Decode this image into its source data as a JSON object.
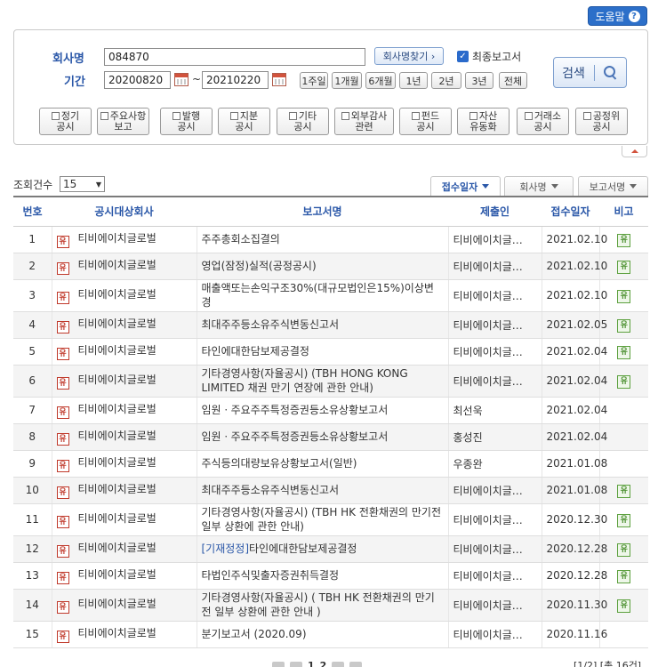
{
  "help": {
    "label": "도움말",
    "icon": "question-icon"
  },
  "search": {
    "company_label": "회사명",
    "company_value": "084870",
    "find_company_label": "회사명찾기 ›",
    "final_report_label": "최종보고서",
    "final_report_checked": true,
    "period_label": "기간",
    "start_date": "20200820",
    "end_date": "20210220",
    "period_sep": "~",
    "period_buttons": [
      "1주일",
      "1개월",
      "6개월",
      "1년",
      "2년",
      "3년",
      "전체"
    ],
    "search_label": "검색",
    "type_buttons": [
      [
        "정기",
        "공시"
      ],
      [
        "주요사항",
        "보고"
      ],
      [
        "발행",
        "공시"
      ],
      [
        "지분",
        "공시"
      ],
      [
        "기타",
        "공시"
      ],
      [
        "외부감사",
        "관련"
      ],
      [
        "펀드",
        "공시"
      ],
      [
        "자산",
        "유동화"
      ],
      [
        "거래소",
        "공시"
      ],
      [
        "공정위",
        "공시"
      ]
    ]
  },
  "list": {
    "count_label": "조회건수",
    "count_value": "15",
    "sort_buttons": [
      "접수일자",
      "회사명",
      "보고서명"
    ],
    "active_sort": "접수일자",
    "headers": [
      "번호",
      "공시대상회사",
      "보고서명",
      "제출인",
      "접수일자",
      "비고"
    ],
    "corp_icon": "유",
    "remark_icon": "유",
    "rows": [
      {
        "no": "1",
        "company": "티비에이치글로벌",
        "report_tag": "",
        "report": "주주총회소집결의",
        "submitter": "티비에이치글…",
        "date": "2021.02.10",
        "remark": true
      },
      {
        "no": "2",
        "company": "티비에이치글로벌",
        "report_tag": "",
        "report": "영업(잠정)실적(공정공시)",
        "submitter": "티비에이치글…",
        "date": "2021.02.10",
        "remark": true
      },
      {
        "no": "3",
        "company": "티비에이치글로벌",
        "report_tag": "",
        "report": "매출액또는손익구조30%(대규모법인은15%)이상변경",
        "submitter": "티비에이치글…",
        "date": "2021.02.10",
        "remark": true
      },
      {
        "no": "4",
        "company": "티비에이치글로벌",
        "report_tag": "",
        "report": "최대주주등소유주식변동신고서",
        "submitter": "티비에이치글…",
        "date": "2021.02.05",
        "remark": true
      },
      {
        "no": "5",
        "company": "티비에이치글로벌",
        "report_tag": "",
        "report": "타인에대한담보제공결정",
        "submitter": "티비에이치글…",
        "date": "2021.02.04",
        "remark": true
      },
      {
        "no": "6",
        "company": "티비에이치글로벌",
        "report_tag": "",
        "report": "기타경영사항(자율공시) (TBH HONG KONG LIMITED 채권 만기 연장에 관한 안내)",
        "submitter": "티비에이치글…",
        "date": "2021.02.04",
        "remark": true
      },
      {
        "no": "7",
        "company": "티비에이치글로벌",
        "report_tag": "",
        "report": "임원ㆍ주요주주특정증권등소유상황보고서",
        "submitter": "최선욱",
        "date": "2021.02.04",
        "remark": false
      },
      {
        "no": "8",
        "company": "티비에이치글로벌",
        "report_tag": "",
        "report": "임원ㆍ주요주주특정증권등소유상황보고서",
        "submitter": "홍성진",
        "date": "2021.02.04",
        "remark": false
      },
      {
        "no": "9",
        "company": "티비에이치글로벌",
        "report_tag": "",
        "report": "주식등의대량보유상황보고서(일반)",
        "submitter": "우종완",
        "date": "2021.01.08",
        "remark": false
      },
      {
        "no": "10",
        "company": "티비에이치글로벌",
        "report_tag": "",
        "report": "최대주주등소유주식변동신고서",
        "submitter": "티비에이치글…",
        "date": "2021.01.08",
        "remark": true
      },
      {
        "no": "11",
        "company": "티비에이치글로벌",
        "report_tag": "",
        "report": "기타경영사항(자율공시) (TBH HK 전환채권의 만기전 일부 상환에 관한 안내)",
        "submitter": "티비에이치글…",
        "date": "2020.12.30",
        "remark": true
      },
      {
        "no": "12",
        "company": "티비에이치글로벌",
        "report_tag": "[기재정정]",
        "report": "타인에대한담보제공결정",
        "submitter": "티비에이치글…",
        "date": "2020.12.28",
        "remark": true
      },
      {
        "no": "13",
        "company": "티비에이치글로벌",
        "report_tag": "",
        "report": "타법인주식및출자증권취득결정",
        "submitter": "티비에이치글…",
        "date": "2020.12.28",
        "remark": true
      },
      {
        "no": "14",
        "company": "티비에이치글로벌",
        "report_tag": "",
        "report": "기타경영사항(자율공시) ( TBH HK 전환채권의 만기전 일부 상환에 관한 안내 )",
        "submitter": "티비에이치글…",
        "date": "2020.11.30",
        "remark": true
      },
      {
        "no": "15",
        "company": "티비에이치글로벌",
        "report_tag": "",
        "report": "분기보고서 (2020.09)",
        "submitter": "티비에이치글…",
        "date": "2020.11.16",
        "remark": false
      }
    ]
  },
  "paging": {
    "pages": [
      "1",
      "2"
    ],
    "info": "[1/2] [총 16건]"
  }
}
